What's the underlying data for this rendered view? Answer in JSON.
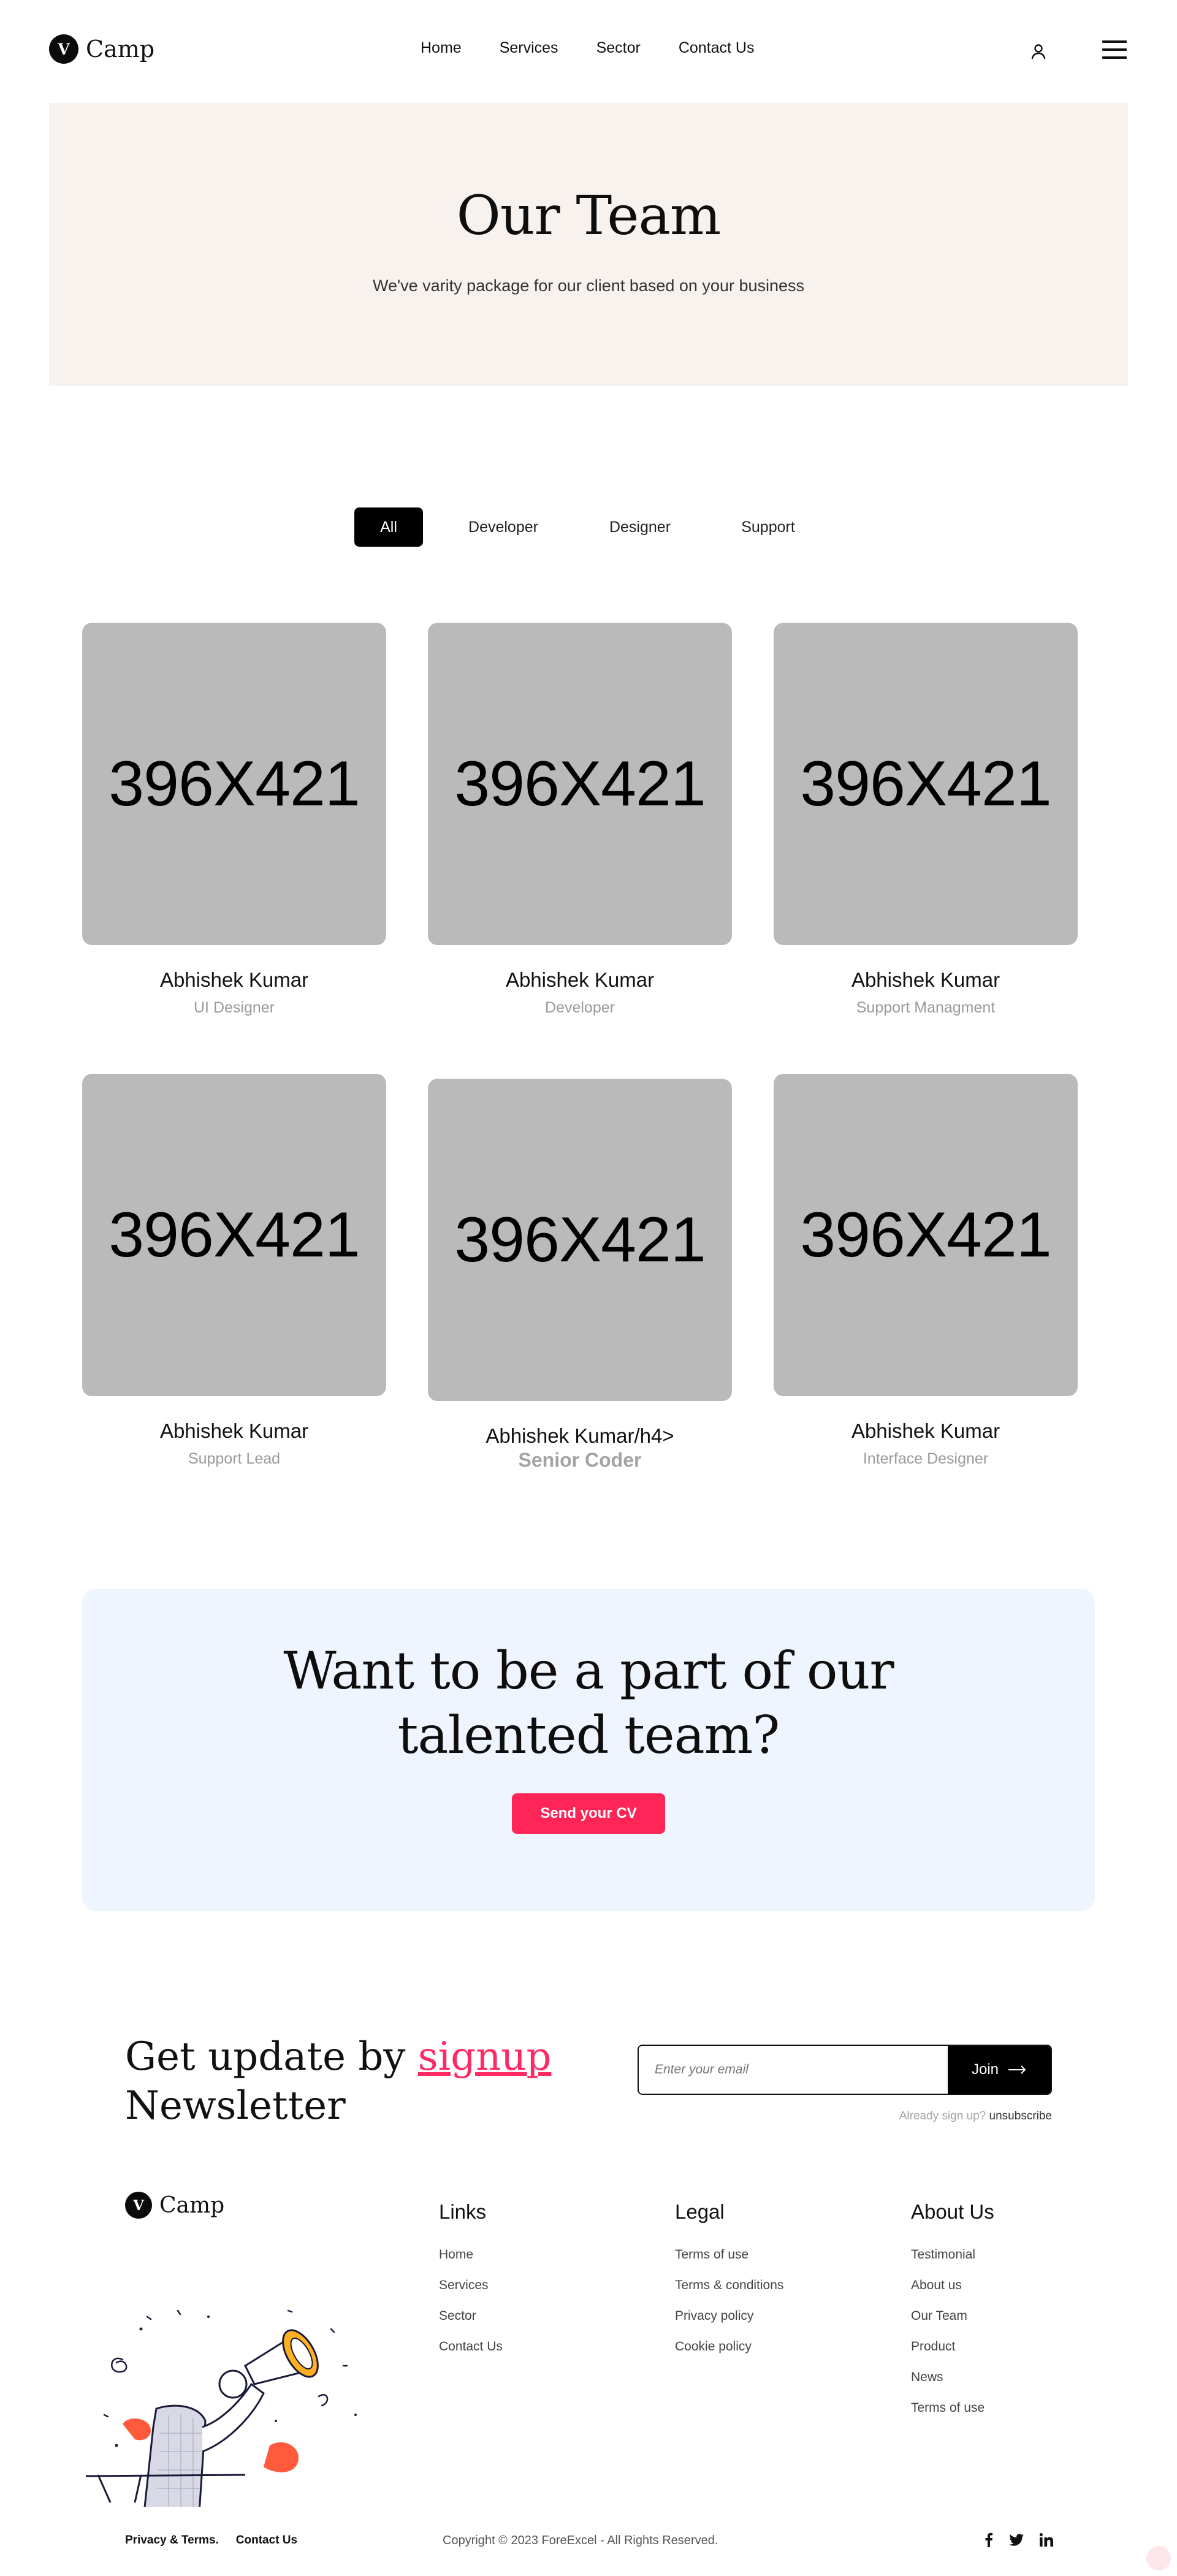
{
  "header": {
    "logo_letter": "V",
    "logo_text": "Camp",
    "nav": [
      "Home",
      "Services",
      "Sector",
      "Contact Us"
    ],
    "icons": [
      "user-icon",
      "hamburger-menu-icon"
    ]
  },
  "hero": {
    "title": "Our Team",
    "subtitle": "We've varity package for our client based on your business"
  },
  "filters": {
    "tabs": [
      "All",
      "Developer",
      "Designer",
      "Support"
    ],
    "active": "All"
  },
  "team": [
    {
      "image": "396X421",
      "name": "Abhishek Kumar",
      "role": "UI Designer"
    },
    {
      "image": "396X421",
      "name": "Abhishek Kumar",
      "role": "Developer"
    },
    {
      "image": "396X421",
      "name": "Abhishek Kumar",
      "role": "Support Managment"
    },
    {
      "image": "396X421",
      "name": "Abhishek Kumar",
      "role": "Support Lead"
    },
    {
      "image": "396X421",
      "name": "Abhishek Kumar/h4>",
      "role": "Senior Coder"
    },
    {
      "image": "396X421",
      "name": "Abhishek Kumar",
      "role": "Interface Designer"
    }
  ],
  "cta": {
    "title_line1": "Want to be a part of our",
    "title_line2": "talented team?",
    "button": "Send your CV"
  },
  "newsletter": {
    "title_prefix": "Get update by ",
    "title_link": "signup",
    "title_suffix": "Newsletter",
    "placeholder": "Enter your email",
    "button": "Join",
    "note_prefix": "Already sign up?",
    "note_link": "unsubscribe"
  },
  "footer": {
    "logo_letter": "V",
    "logo_text": "Camp",
    "links": {
      "title": "Links",
      "items": [
        "Home",
        "Services",
        "Sector",
        "Contact Us"
      ]
    },
    "legal": {
      "title": "Legal",
      "items": [
        "Terms of use",
        "Terms & conditions",
        "Privacy policy",
        "Cookie policy"
      ]
    },
    "about": {
      "title": "About Us",
      "items": [
        "Testimonial",
        "About us",
        "Our Team",
        "Product",
        "News",
        "Terms of use"
      ]
    },
    "bottom_links": [
      "Privacy & Terms.",
      "Contact Us"
    ],
    "copyright": "Copyright © 2023 ForeExcel - All Rights Reserved.",
    "social": [
      "facebook-icon",
      "twitter-icon",
      "linkedin-icon"
    ]
  },
  "colors": {
    "accent": "#ff2556",
    "hero_bg": "#f8f2ee",
    "cta_bg": "#eff5fe",
    "placeholder_bg": "#bababa"
  }
}
